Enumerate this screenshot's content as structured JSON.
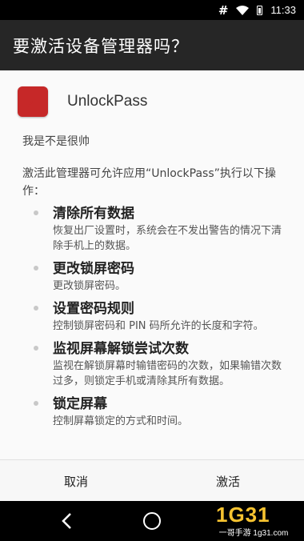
{
  "status_bar": {
    "signal_glyph": "#",
    "time": "11:33",
    "icons": [
      "hash-icon",
      "wifi-icon",
      "battery-icon"
    ]
  },
  "dialog": {
    "title": "要激活设备管理器吗？",
    "app_name": "UnlockPass",
    "app_description": "我是不是很帅",
    "intro": "激活此管理器可允许应用“UnlockPass”执行以下操作：",
    "policies": [
      {
        "title": "清除所有数据",
        "description": "恢复出厂设置时，系统会在不发出警告的情况下清除手机上的数据。"
      },
      {
        "title": "更改锁屏密码",
        "description": "更改锁屏密码。"
      },
      {
        "title": "设置密码规则",
        "description": "控制锁屏密码和 PIN 码所允许的长度和字符。"
      },
      {
        "title": "监视屏幕解锁尝试次数",
        "description": "监视在解锁屏幕时输错密码的次数，如果输错次数过多，则锁定手机或清除其所有数据。"
      },
      {
        "title": "锁定屏幕",
        "description": "控制屏幕锁定的方式和时间。"
      }
    ],
    "buttons": {
      "cancel": "取消",
      "activate": "激活"
    }
  },
  "nav_bar": {
    "icons": [
      "back-icon",
      "home-icon"
    ]
  },
  "watermark": {
    "logo": "1G31",
    "text": "一哥手游 1g31.com"
  },
  "colors": {
    "title_bar": "#262626",
    "app_icon": "#c62828",
    "status_bar": "#000000",
    "nav_bar": "#000000"
  }
}
